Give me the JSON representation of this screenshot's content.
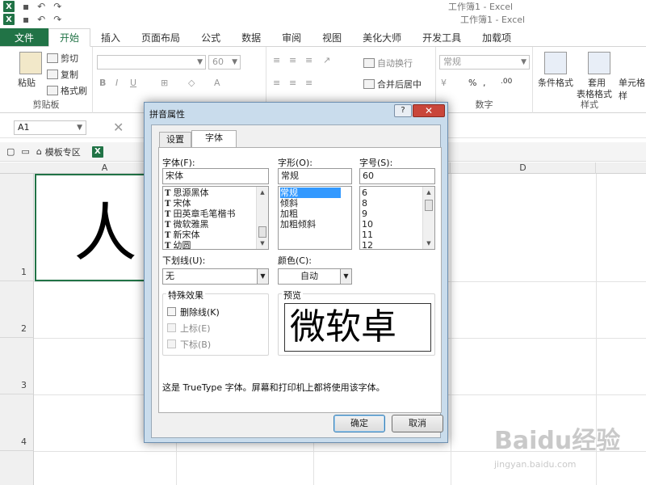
{
  "windows": [
    {
      "title": "工作簿1 - Excel"
    },
    {
      "title": "工作簿1 - Excel"
    }
  ],
  "app_logo": "X",
  "ribbon_tabs": [
    "文件",
    "开始",
    "插入",
    "页面布局",
    "公式",
    "数据",
    "审阅",
    "视图",
    "美化大师",
    "开发工具",
    "加载项"
  ],
  "ribbon": {
    "clipboard": {
      "paste": "粘贴",
      "cut": "剪切",
      "copy": "复制",
      "format_painter": "格式刷",
      "group_label": "剪贴板"
    },
    "font": {
      "font_size": "60"
    },
    "alignment": {
      "wrap_text": "自动换行",
      "merge_center": "合并后居中"
    },
    "number": {
      "format": "常规",
      "group_label": "数字"
    },
    "styles": {
      "conditional_format": "条件格式",
      "table_format_1": "套用",
      "table_format_2": "表格格式",
      "cell_styles": "单元格样",
      "group_label": "样式"
    }
  },
  "name_box": "A1",
  "doc_strip": {
    "template_tab": "模板专区"
  },
  "sheet": {
    "columns": [
      "A",
      "D"
    ],
    "rows": [
      "1",
      "2",
      "3",
      "4"
    ],
    "cell_a1_value": "人"
  },
  "dialog": {
    "title": "拼音属性",
    "help": "?",
    "close": "✕",
    "tabs": [
      "设置",
      "字体"
    ],
    "font_label": "字体(F):",
    "font_value": "宋体",
    "font_list": [
      "思源黑体",
      "宋体",
      "田英章毛笔楷书",
      "微软雅黑",
      "新宋体",
      "幼圆"
    ],
    "style_label": "字形(O):",
    "style_value": "常规",
    "style_list": [
      "常规",
      "倾斜",
      "加粗",
      "加粗倾斜"
    ],
    "size_label": "字号(S):",
    "size_value": "60",
    "size_list": [
      "6",
      "8",
      "9",
      "10",
      "11",
      "12"
    ],
    "underline_label": "下划线(U):",
    "underline_value": "无",
    "color_label": "颜色(C):",
    "color_value": "自动",
    "effects_label": "特殊效果",
    "strike_label": "删除线(K)",
    "super_label": "上标(E)",
    "sub_label": "下标(B)",
    "preview_label": "预览",
    "preview_text": "微软卓",
    "info": "这是 TrueType 字体。屏幕和打印机上都将使用该字体。",
    "ok": "确定",
    "cancel": "取消"
  },
  "watermark": {
    "main": "Baidu经验",
    "sub": "jingyan.baidu.com"
  },
  "colors": {
    "excel_green": "#217346",
    "dialog_frame": "#c9dcec",
    "selection": "#3399ff",
    "close_red": "#c9463a"
  }
}
